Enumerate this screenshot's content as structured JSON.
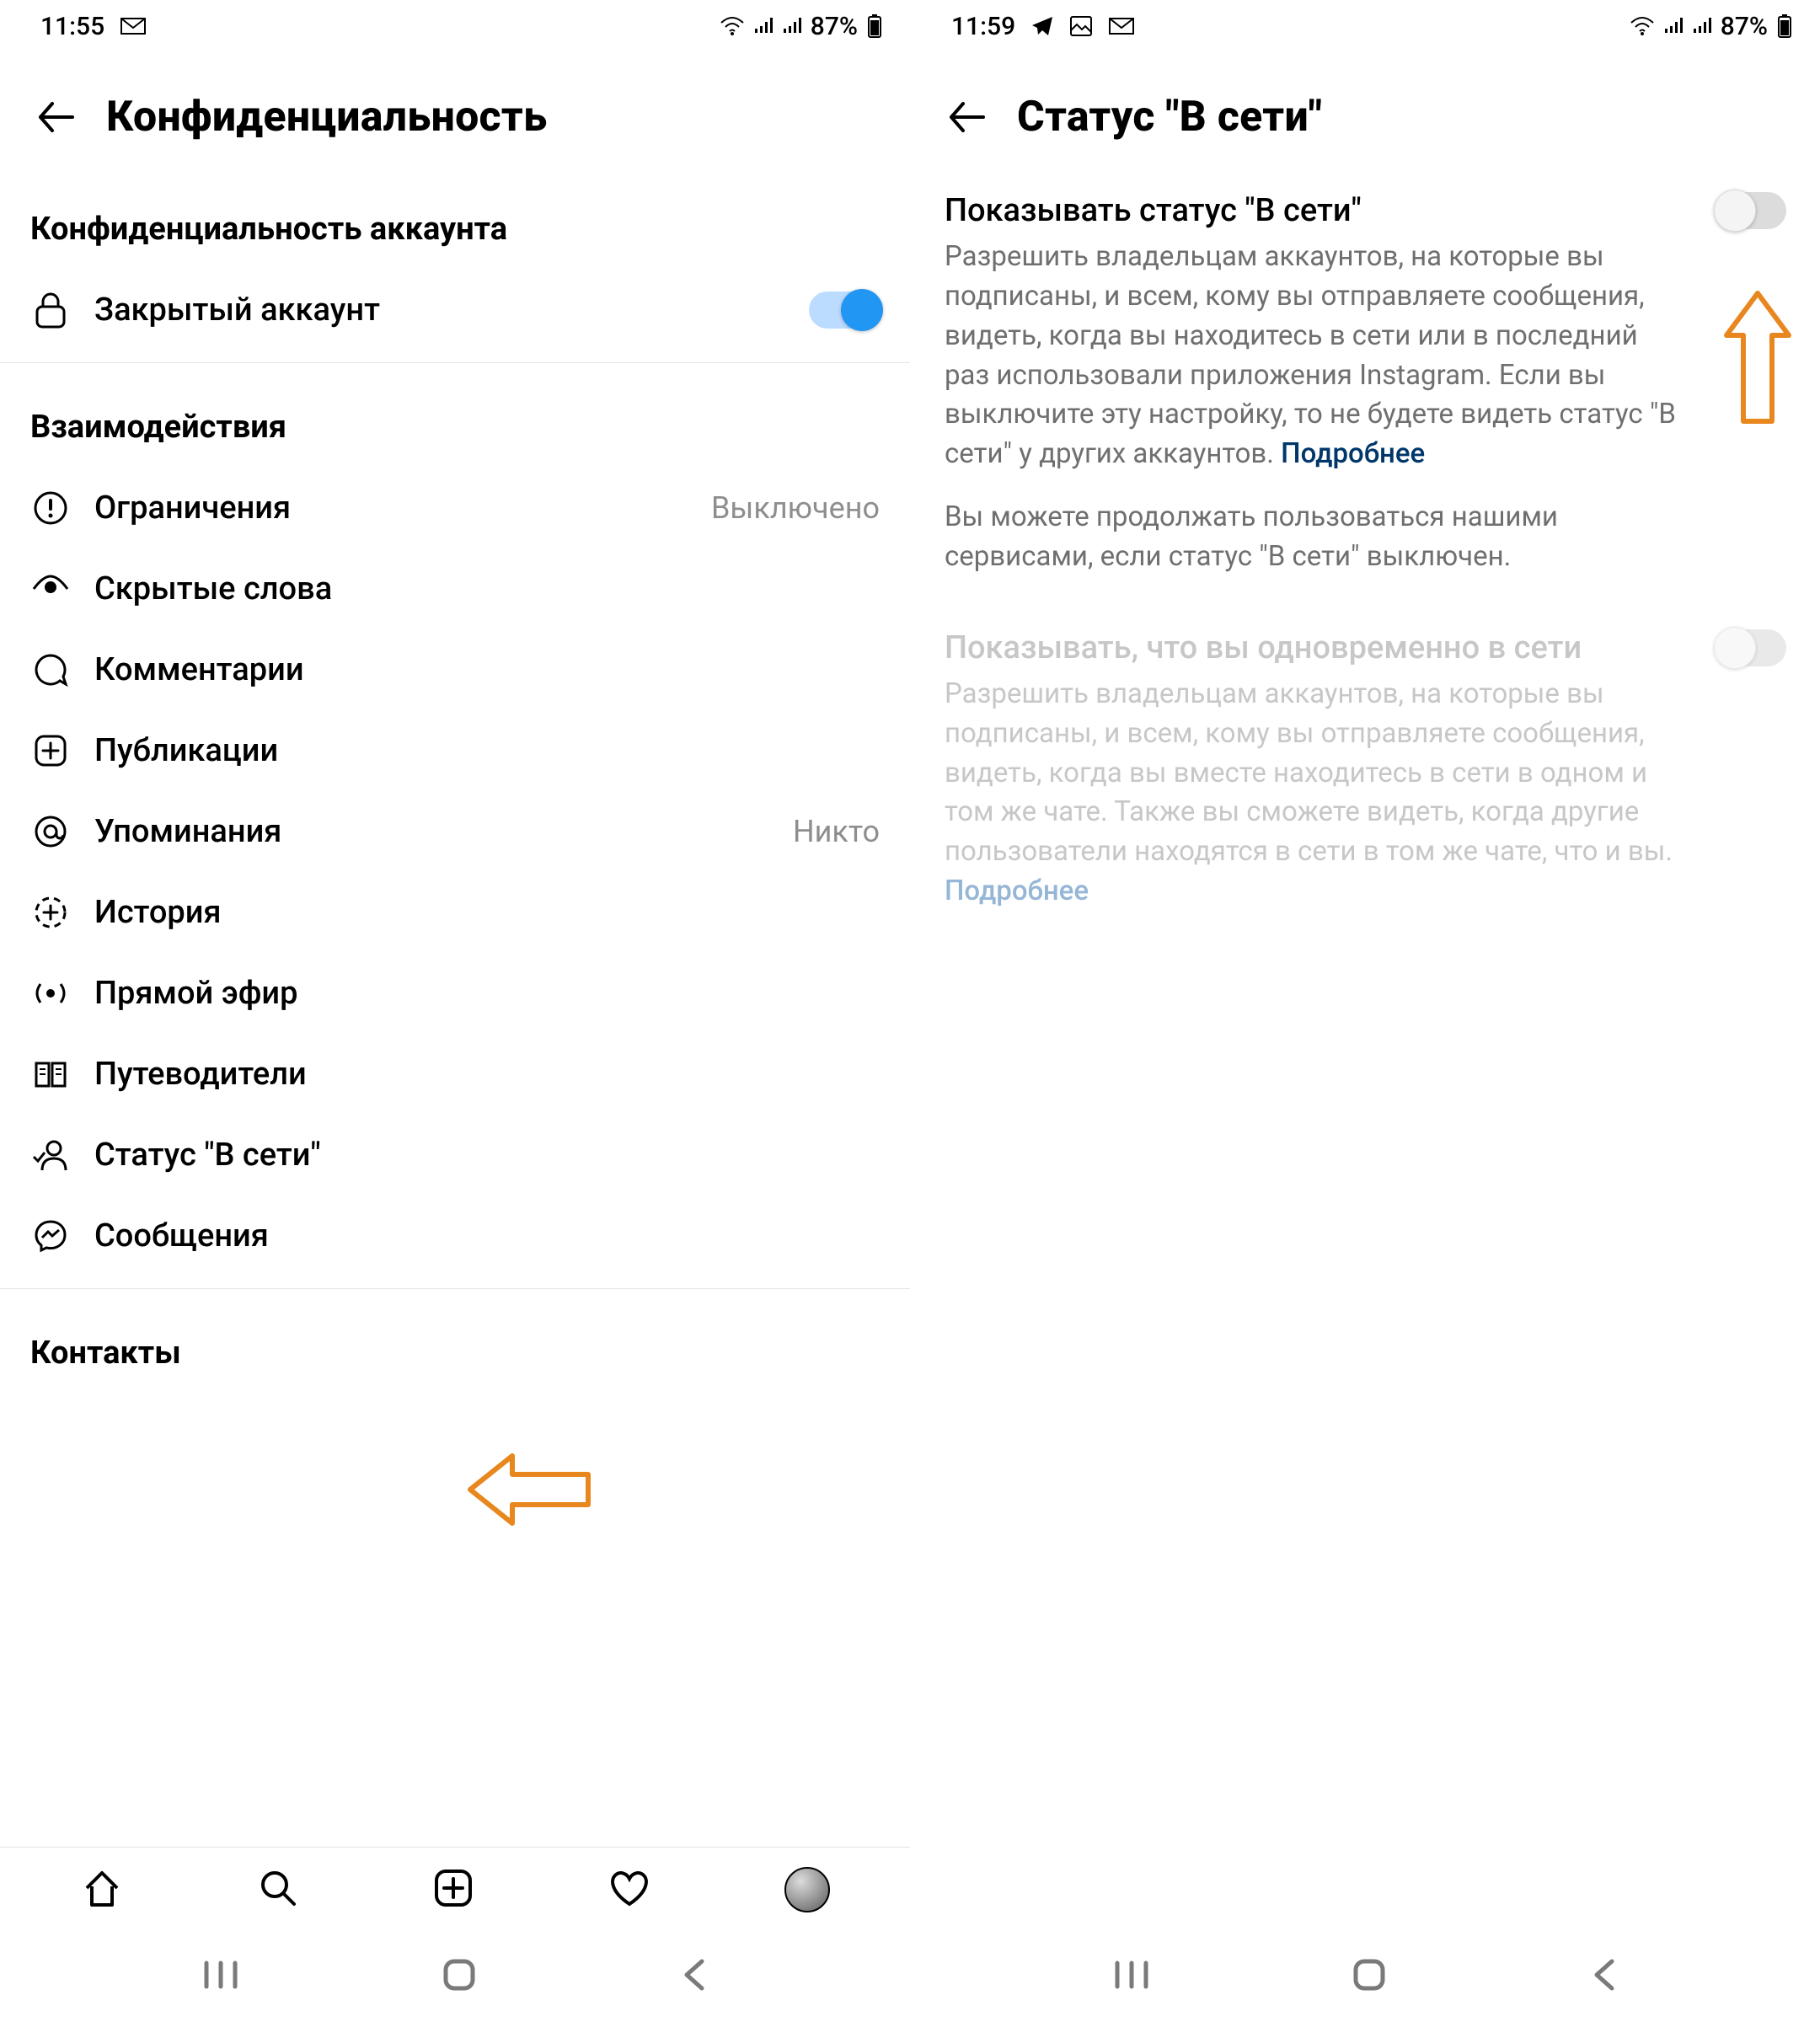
{
  "left": {
    "status": {
      "time": "11:55",
      "battery": "87%"
    },
    "title": "Конфиденциальность",
    "sections": {
      "account": {
        "title": "Конфиденциальность аккаунта",
        "private": {
          "label": "Закрытый аккаунт",
          "on": true
        }
      },
      "interactions": {
        "title": "Взаимодействия",
        "items": [
          {
            "icon": "alert-circle",
            "label": "Ограничения",
            "value": "Выключено"
          },
          {
            "icon": "eye-hidden",
            "label": "Скрытые слова",
            "value": ""
          },
          {
            "icon": "comment",
            "label": "Комментарии",
            "value": ""
          },
          {
            "icon": "plus-square",
            "label": "Публикации",
            "value": ""
          },
          {
            "icon": "at",
            "label": "Упоминания",
            "value": "Никто"
          },
          {
            "icon": "story-plus",
            "label": "История",
            "value": ""
          },
          {
            "icon": "live",
            "label": "Прямой эфир",
            "value": ""
          },
          {
            "icon": "guides",
            "label": "Путеводители",
            "value": ""
          },
          {
            "icon": "activity-status",
            "label": "Статус \"В сети\"",
            "value": ""
          },
          {
            "icon": "messenger",
            "label": "Сообщения",
            "value": ""
          }
        ]
      },
      "contacts": {
        "title": "Контакты"
      }
    }
  },
  "right": {
    "status": {
      "time": "11:59",
      "battery": "87%"
    },
    "title": "Статус \"В сети\"",
    "show_status": {
      "title": "Показывать статус \"В сети\"",
      "desc": "Разрешить владельцам аккаунтов, на которые вы подписаны, и всем, кому вы отправляете сообщения, видеть, когда вы находитесь в сети или в последний раз использовали приложения Instagram. Если вы выключите эту настройку, то не будете видеть статус \"В сети\" у других аккаунтов. ",
      "more": "Подробнее",
      "desc2": "Вы можете продолжать пользоваться нашими сервисами, если статус \"В сети\" выключен.",
      "on": false
    },
    "show_together": {
      "title": "Показывать, что вы одновременно в сети",
      "desc": "Разрешить владельцам аккаунтов, на которые вы подписаны, и всем, кому вы отправляете сообщения, видеть, когда вы вместе находитесь в сети в одном и том же чате. Также вы сможете видеть, когда другие пользователи находятся в сети в том же чате, что и вы. ",
      "more": "Подробнее",
      "on": false
    }
  }
}
